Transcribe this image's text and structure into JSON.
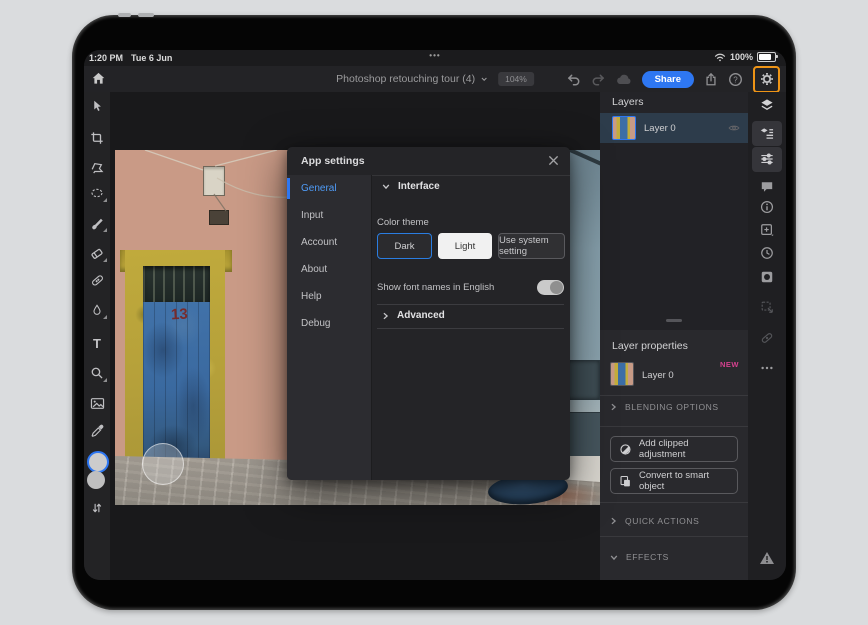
{
  "status": {
    "time": "1:20 PM",
    "date": "Tue 6 Jun",
    "battery": "100%",
    "multitask": "•••"
  },
  "topbar": {
    "title": "Photoshop retouching tour (4)",
    "zoom_badge": "104%",
    "share_label": "Share",
    "help_mark": "?"
  },
  "tools": {
    "type_glyph": "T"
  },
  "canvas": {
    "door_number": "13"
  },
  "layers_panel": {
    "title": "Layers",
    "layer0": "Layer 0"
  },
  "properties": {
    "title": "Layer properties",
    "layer0": "Layer 0",
    "new_badge": "NEW",
    "blending_options": "BLENDING OPTIONS",
    "add_clipped": "Add clipped adjustment",
    "convert_smart": "Convert to smart object",
    "quick_actions": "QUICK ACTIONS",
    "effects": "EFFECTS"
  },
  "dialog": {
    "title": "App settings",
    "nav": [
      {
        "label": "General"
      },
      {
        "label": "Input"
      },
      {
        "label": "Account"
      },
      {
        "label": "About"
      },
      {
        "label": "Help"
      },
      {
        "label": "Debug"
      }
    ],
    "interface_section": "Interface",
    "color_theme": "Color theme",
    "themes": [
      "Dark",
      "Light",
      "Use system setting"
    ],
    "selected_theme": "Dark",
    "font_names": "Show font names in English",
    "advanced_section": "Advanced"
  },
  "colors": {
    "accent_blue": "#2e77f2",
    "highlight_orange": "#ee9416",
    "new_badge_pink": "#d4418e"
  }
}
